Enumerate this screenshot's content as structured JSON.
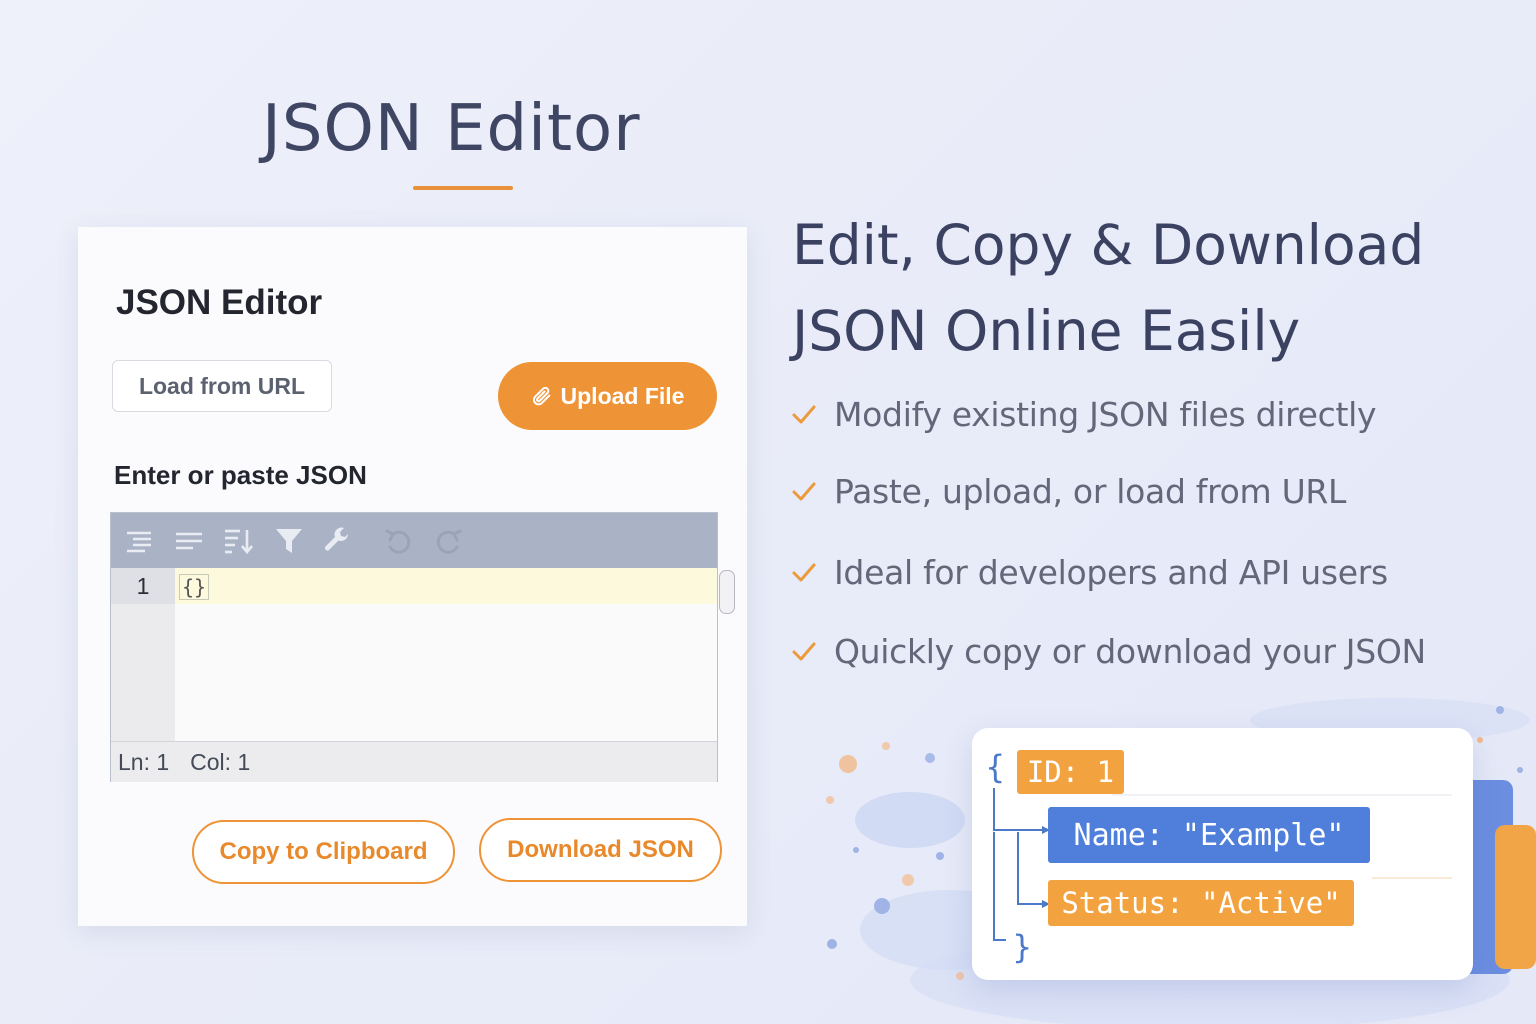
{
  "page": {
    "title": "JSON Editor",
    "accent_color": "#e8913a"
  },
  "card": {
    "title": "JSON Editor",
    "load_url_label": "Load from URL",
    "upload_label": "Upload File",
    "upload_icon": "paperclip-icon",
    "enter_label": "Enter or paste JSON",
    "editor": {
      "toolbar_icons": [
        "format-icon",
        "compact-icon",
        "sort-icon",
        "filter-icon",
        "repair-icon",
        "undo-icon",
        "redo-icon"
      ],
      "line_number": "1",
      "content": "{}",
      "status_line": "Ln: 1",
      "status_col": "Col: 1"
    },
    "copy_label": "Copy to Clipboard",
    "download_label": "Download JSON"
  },
  "promo": {
    "headline": "Edit, Copy & Download JSON Online Easily",
    "features": [
      "Modify existing JSON files directly",
      "Paste, upload, or load from URL",
      "Ideal for developers and API users",
      "Quickly copy or download your JSON"
    ],
    "check_icon": "checkmark-icon"
  },
  "illustration": {
    "open_brace": "{",
    "close_brace": "}",
    "id_tag": "ID: 1",
    "name_tag": "Name: \"Example\"",
    "status_tag": "Status: \"Active\"",
    "colors": {
      "blue": "#4f7fdb",
      "orange": "#f2a33f"
    }
  }
}
